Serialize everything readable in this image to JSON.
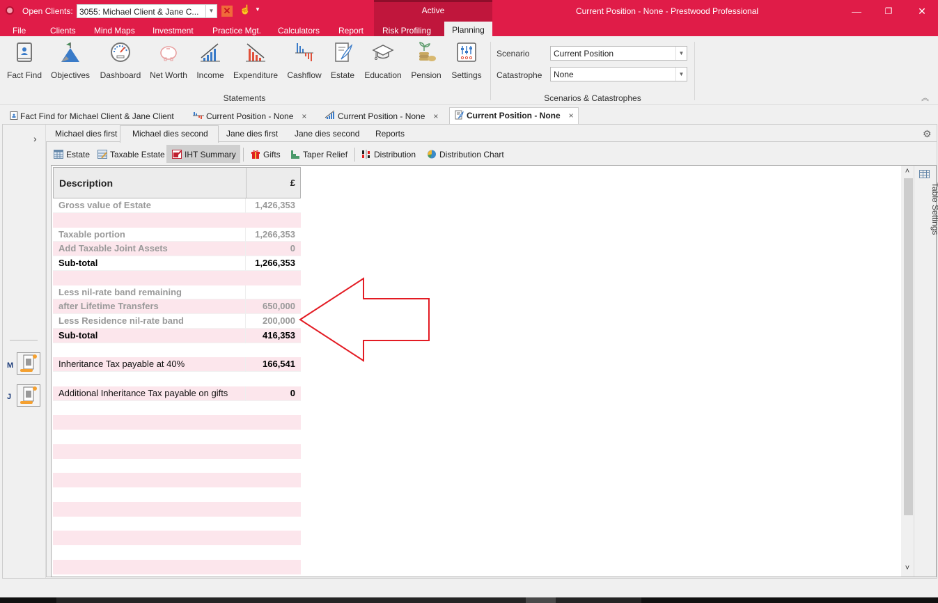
{
  "titlebar": {
    "open_clients_label": "Open Clients:",
    "client_selected": "3055: Michael Client & Jane C...",
    "context_group": "Active",
    "window_title": "Current Position - None - Prestwood Professional",
    "minimize": "—",
    "restore": "❐",
    "close": "✕"
  },
  "menu": {
    "items": [
      "File",
      "Clients",
      "Mind Maps",
      "Investment",
      "Practice Mgt.",
      "Calculators",
      "Report",
      "Risk Profiling",
      "Planning"
    ],
    "active": "Planning"
  },
  "ribbon": {
    "buttons": [
      {
        "label": "Fact Find",
        "icon": "fact-find-icon"
      },
      {
        "label": "Objectives",
        "icon": "mountain-flag-icon"
      },
      {
        "label": "Dashboard",
        "icon": "speedometer-icon"
      },
      {
        "label": "Net Worth",
        "icon": "piggy-bank-icon"
      },
      {
        "label": "Income",
        "icon": "rising-bars-icon"
      },
      {
        "label": "Expenditure",
        "icon": "falling-bars-icon"
      },
      {
        "label": "Cashflow",
        "icon": "cashflow-icon"
      },
      {
        "label": "Estate",
        "icon": "quill-document-icon"
      },
      {
        "label": "Education",
        "icon": "graduation-cap-icon"
      },
      {
        "label": "Pension",
        "icon": "coins-plant-icon"
      },
      {
        "label": "Settings",
        "icon": "sliders-icon"
      }
    ],
    "statements_group": "Statements",
    "scenario_label": "Scenario",
    "scenario_value": "Current Position",
    "catastrophe_label": "Catastrophe",
    "catastrophe_value": "None",
    "scenarios_group": "Scenarios & Catastrophes"
  },
  "doc_tabs": [
    {
      "label": "Fact Find for Michael Client & Jane Client",
      "closable": false
    },
    {
      "label": "Current Position - None",
      "closable": true
    },
    {
      "label": "Current Position - None",
      "closable": true
    },
    {
      "label": "Current Position - None",
      "closable": true,
      "active": true
    }
  ],
  "close_glyph": "×",
  "scenario_tabs": [
    "Michael dies first",
    "Michael dies second",
    "Jane dies first",
    "Jane dies second",
    "Reports"
  ],
  "scenario_tab_active": "Michael dies second",
  "sub_toolbar": [
    "Estate",
    "Taxable Estate",
    "IHT Summary",
    "Gifts",
    "Taper Relief",
    "Distribution",
    "Distribution Chart"
  ],
  "sub_toolbar_active": "IHT Summary",
  "left_panel": {
    "expand": "›",
    "persons": [
      {
        "initial": "M"
      },
      {
        "initial": "J"
      }
    ]
  },
  "table": {
    "headers": {
      "description": "Description",
      "value": "£"
    },
    "rows": [
      {
        "desc": "Gross value of Estate",
        "value": "1,426,353",
        "style": "grey"
      },
      {
        "desc": "",
        "value": "",
        "style": "empty"
      },
      {
        "desc": "Taxable portion",
        "value": "1,266,353",
        "style": "grey"
      },
      {
        "desc": "Add Taxable Joint Assets",
        "value": "0",
        "style": "grey"
      },
      {
        "desc": "Sub-total",
        "value": "1,266,353",
        "style": "bold"
      },
      {
        "desc": "",
        "value": "",
        "style": "empty"
      },
      {
        "desc": "Less nil-rate band remaining",
        "value": "",
        "style": "grey"
      },
      {
        "desc": "after Lifetime Transfers",
        "value": "650,000",
        "style": "grey"
      },
      {
        "desc": "Less Residence nil-rate band",
        "value": "200,000",
        "style": "grey"
      },
      {
        "desc": "Sub-total",
        "value": "416,353",
        "style": "bold"
      },
      {
        "desc": "",
        "value": "",
        "style": "empty"
      },
      {
        "desc": "Inheritance Tax payable at 40%",
        "value": "166,541",
        "style": "plain"
      },
      {
        "desc": "",
        "value": "",
        "style": "empty"
      },
      {
        "desc": "Additional Inheritance Tax payable on gifts",
        "value": "0",
        "style": "plain"
      }
    ],
    "blank_rows": 13
  },
  "side": {
    "table_settings": "Table Settings"
  },
  "annotation": {
    "type": "arrow",
    "direction": "left",
    "points_to": "Less Residence nil-rate band",
    "color": "#e31b23"
  },
  "colors": {
    "brand": "#e01c48",
    "row_alt": "#fce6ec"
  }
}
